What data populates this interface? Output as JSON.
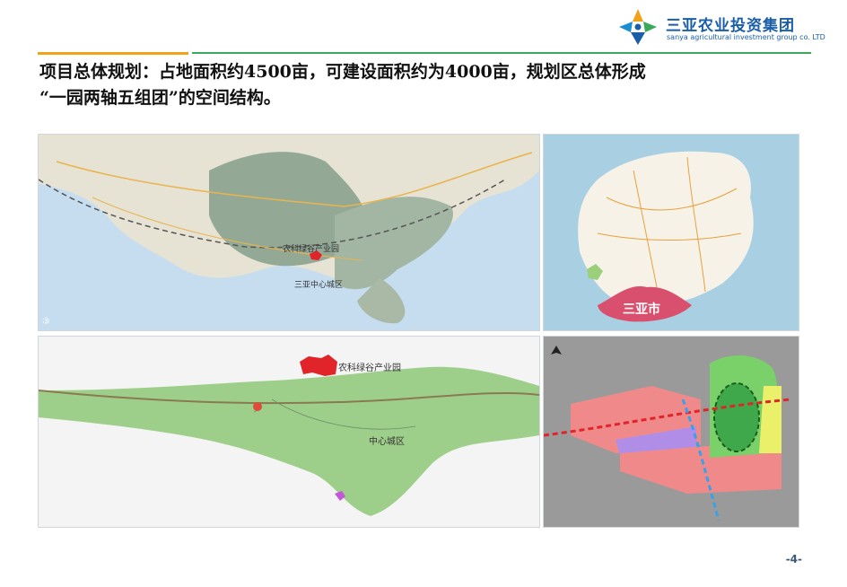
{
  "brand": {
    "name_cn": "三亚农业投资集团",
    "name_en": "sanya agricultural investment group co. LTD"
  },
  "heading": {
    "line1": "项目总体规划：占地面积约4500亩，可建设面积约为4000亩，规划区总体形成",
    "line2": "“一园两轴五组团”的空间结构。"
  },
  "map1": {
    "park_label": "农科绿谷产业园",
    "center_label": "三亚中心城区",
    "corner_mark": "③"
  },
  "map2": {
    "city_label": "三亚市"
  },
  "map3": {
    "park_label": "农科绿谷产业园",
    "center_label": "中心城区"
  },
  "page": {
    "number": "-4-"
  },
  "colors": {
    "brand_blue": "#1a5ea8",
    "accent_orange": "#f0a21a",
    "accent_green": "#3aaa5a",
    "park_red": "#e0242a"
  }
}
